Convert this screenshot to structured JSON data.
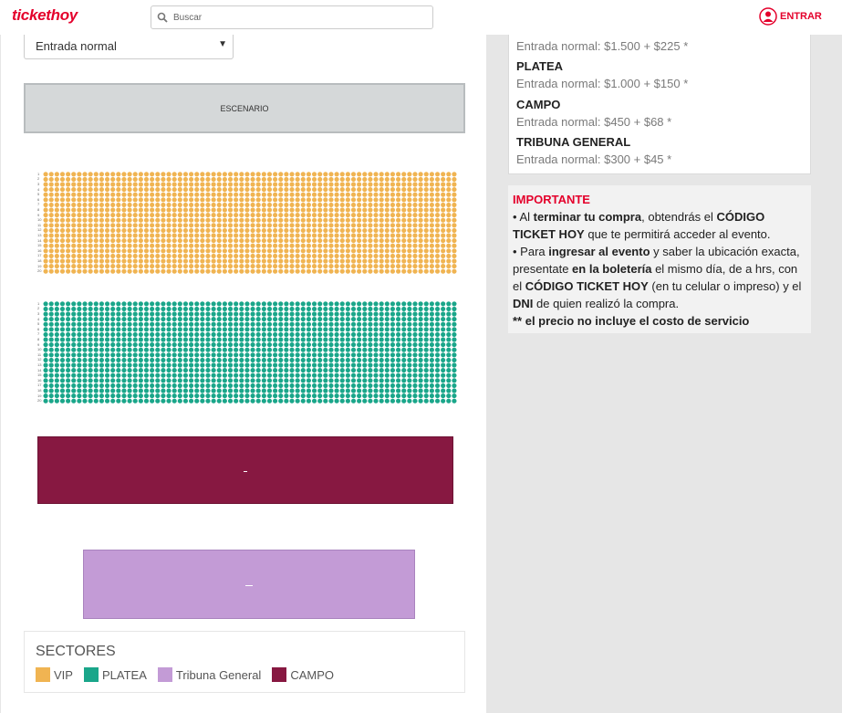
{
  "header": {
    "logo": "tickethoy",
    "search_placeholder": "Buscar",
    "login_label": "ENTRAR",
    "brand_color": "#e4002b"
  },
  "ticket_select": {
    "value": "Entrada normal"
  },
  "map": {
    "stage_label": "ESCENARIO",
    "vip": {
      "color": "#f0b452",
      "rows": [
        "1",
        "2",
        "3",
        "4",
        "5",
        "6",
        "7",
        "8",
        "9",
        "10",
        "11",
        "12",
        "13",
        "14",
        "15",
        "16",
        "17",
        "18",
        "19",
        "20"
      ],
      "seats_per_row": 74
    },
    "platea": {
      "color": "#1aa68a",
      "rows": [
        "1",
        "2",
        "3",
        "4",
        "5",
        "6",
        "7",
        "8",
        "9",
        "10",
        "11",
        "12",
        "13",
        "14",
        "15",
        "16",
        "17",
        "18",
        "19",
        "20"
      ],
      "seats_per_row": 74
    },
    "campo": {
      "color": "#871841"
    },
    "tribuna": {
      "color": "#c39bd6"
    }
  },
  "legend": {
    "title": "SECTORES",
    "items": [
      {
        "label": "VIP",
        "color": "#f0b452"
      },
      {
        "label": "PLATEA",
        "color": "#1aa68a"
      },
      {
        "label": "Tribuna General",
        "color": "#c39bd6"
      },
      {
        "label": "CAMPO",
        "color": "#871841"
      }
    ]
  },
  "prices": {
    "partial_line": "Entrada normal: $1.500 + $225 *",
    "sections": [
      {
        "name": "PLATEA",
        "line": "Entrada normal: $1.000 + $150 *"
      },
      {
        "name": "CAMPO",
        "line": "Entrada normal: $450 + $68 *"
      },
      {
        "name": "TRIBUNA GENERAL",
        "line": "Entrada normal: $300 + $45 *"
      }
    ]
  },
  "important": {
    "title": "IMPORTANTE",
    "p1_a": "• Al ",
    "p1_b": "terminar tu compra",
    "p1_c": ", obtendrás el ",
    "p1_d": "CÓDIGO TICKET HOY",
    "p1_e": " que te permitirá acceder al evento.",
    "p2_a": "• Para ",
    "p2_b": "ingresar al evento",
    "p2_c": " y saber la ubicación exacta, presentate ",
    "p2_d": "en la boletería",
    "p2_e": " el mismo día, de a hrs, con el ",
    "p2_f": "CÓDIGO TICKET HOY",
    "p2_g": " (en tu celular o impreso) y el ",
    "p2_h": "DNI",
    "p2_i": " de quien realizó la compra.",
    "p3": "** el precio no incluye el costo de servicio"
  }
}
